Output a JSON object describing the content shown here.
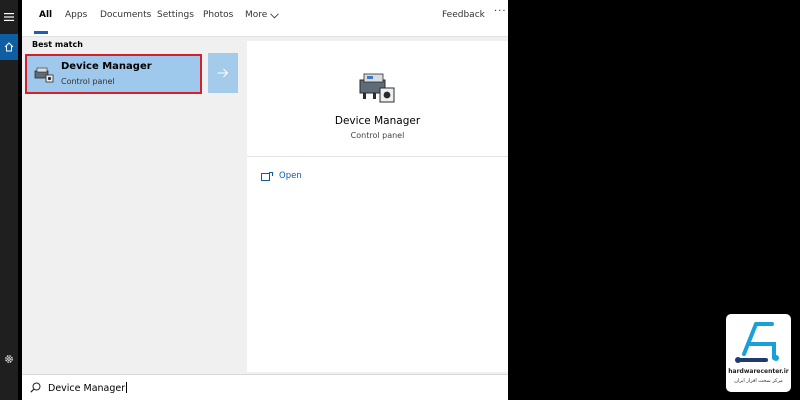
{
  "tabs": [
    {
      "label": "All",
      "active": true
    },
    {
      "label": "Apps"
    },
    {
      "label": "Documents"
    },
    {
      "label": "Settings"
    },
    {
      "label": "Photos"
    },
    {
      "label": "More"
    }
  ],
  "header": {
    "feedback_label": "Feedback",
    "more_options_label": "···"
  },
  "results": {
    "section_label": "Best match",
    "best_match": {
      "title": "Device Manager",
      "subtitle": "Control panel",
      "icon": "device-manager-icon"
    }
  },
  "preview": {
    "title": "Device Manager",
    "subtitle": "Control panel",
    "actions": [
      {
        "label": "Open",
        "icon": "open-window-icon"
      }
    ]
  },
  "search": {
    "value": "Device Manager"
  },
  "watermark": {
    "site": "hardwarecenter.ir",
    "tagline": "مرکز سخت افزار ایران"
  },
  "colors": {
    "accent": "#0e5ea4",
    "selection": "#9fc9ec",
    "highlight_border": "#d3202a"
  }
}
